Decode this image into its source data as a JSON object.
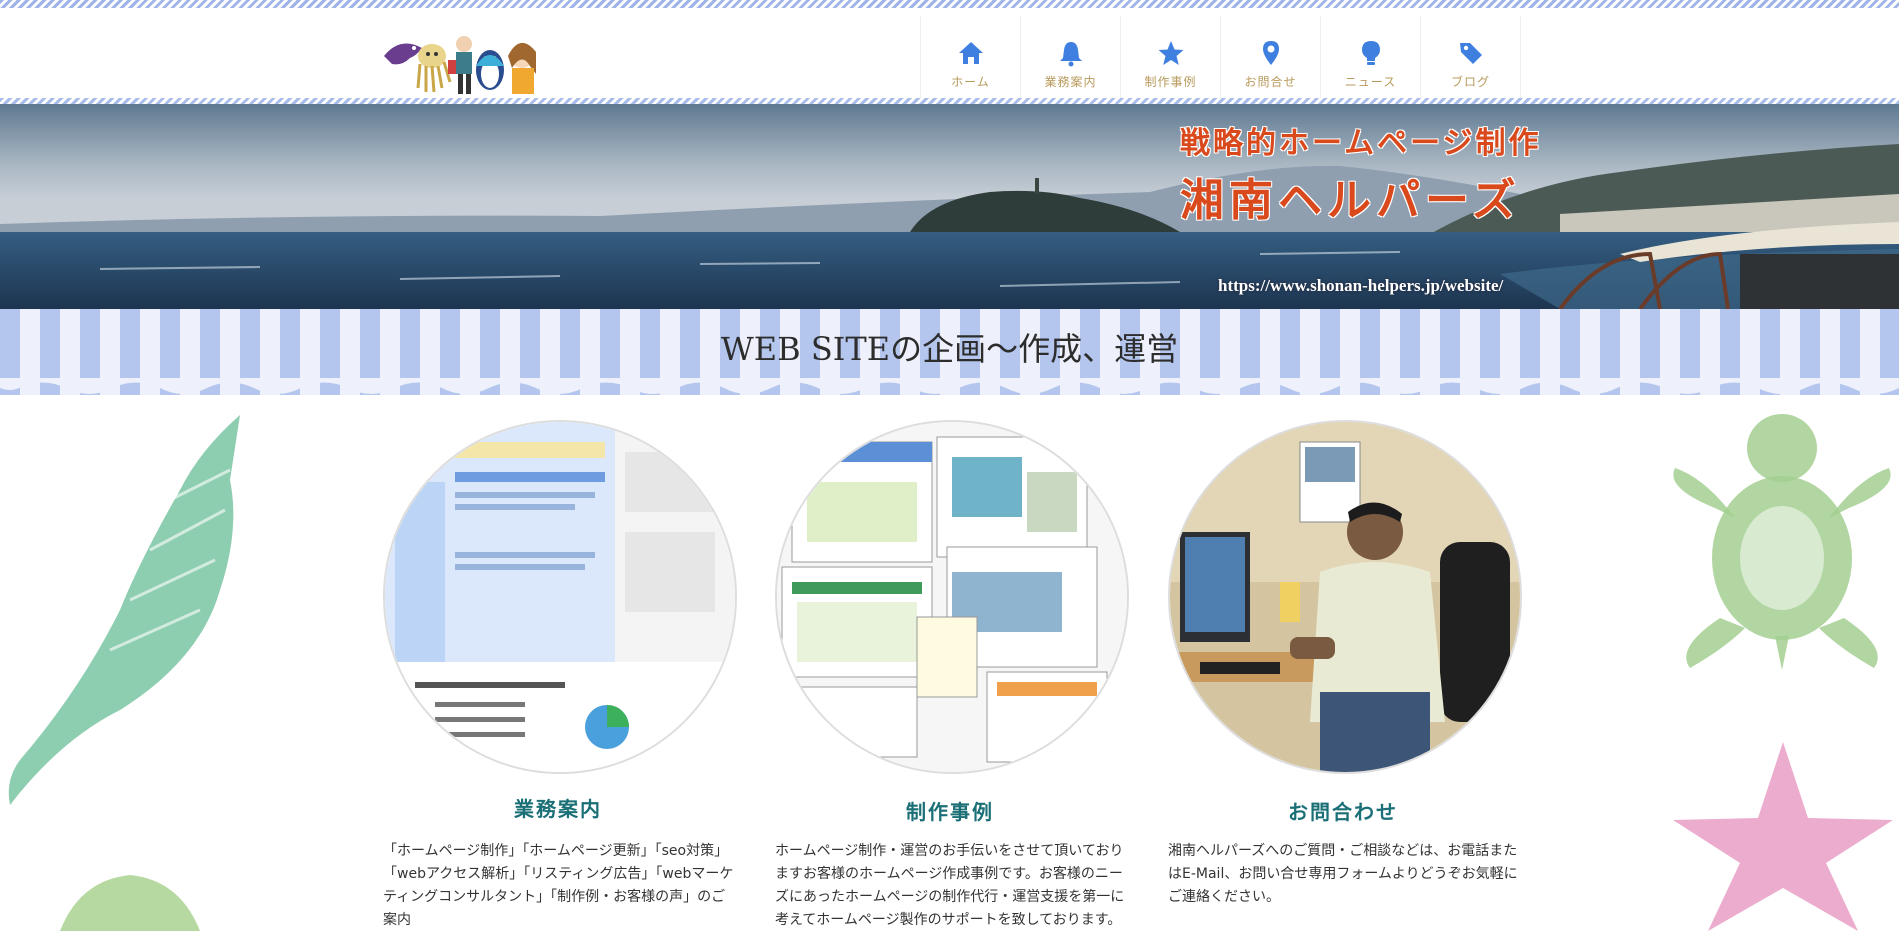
{
  "nav": {
    "items": [
      {
        "label": "ホーム",
        "icon": "home-icon"
      },
      {
        "label": "業務案内",
        "icon": "bell-icon"
      },
      {
        "label": "制作事例",
        "icon": "star-icon"
      },
      {
        "label": "お問合せ",
        "icon": "map-pin-icon"
      },
      {
        "label": "ニュース",
        "icon": "lightbulb-icon"
      },
      {
        "label": "ブログ",
        "icon": "tag-icon"
      }
    ]
  },
  "hero": {
    "title_line1": "戦略的ホームページ制作",
    "title_line2": "湘南ヘルパーズ",
    "url": "https://www.shonan-helpers.jp/website/"
  },
  "band": {
    "title": "WEB SITEの企画～作成、運営"
  },
  "columns": [
    {
      "heading": "業務案内",
      "text": "「ホームページ制作」「ホームページ更新」「seo対策」「webアクセス解析」「リスティング広告」「webマーケティングコンサルタント」「制作例・お客様の声」のご案内"
    },
    {
      "heading": "制作事例",
      "text": "ホームページ制作・運営のお手伝いをさせて頂いておりますお客様のホームページ作成事例です。お客様のニーズにあったホームページの制作代行・運営支援を第一に考えてホームページ製作のサポートを致しております。"
    },
    {
      "heading": "お問合わせ",
      "text": "湘南ヘルパーズへのご質問・ご相談などは、お電話またはE-Mail、お問い合せ専用フォームよりどうぞお気軽にご連絡ください。"
    }
  ],
  "colors": {
    "nav_icon": "#3f7fe0",
    "nav_label": "#b89a5b",
    "hero_title": "#d9491c",
    "heading": "#1b6f76",
    "stripe_blue": "#b4c6ee"
  }
}
